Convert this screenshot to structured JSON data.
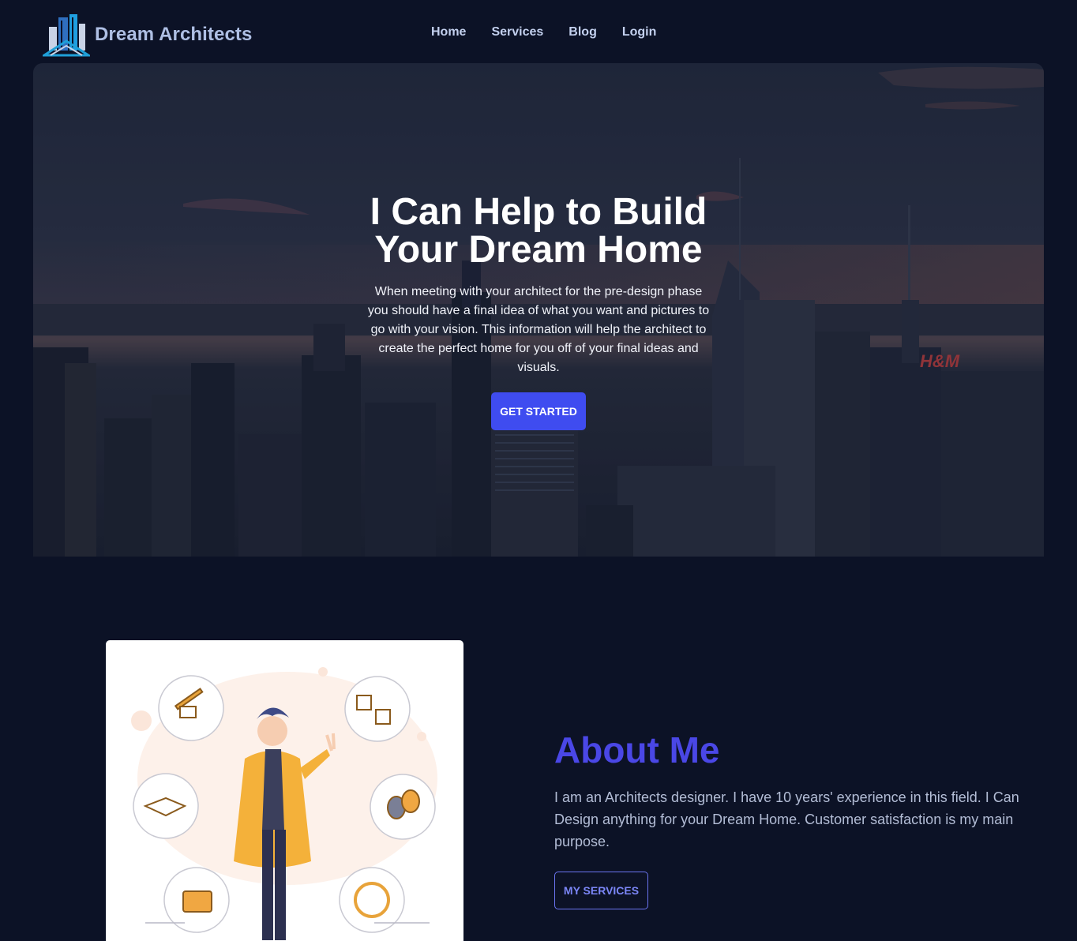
{
  "brand": {
    "name": "Dream Architects",
    "logo_icon": "city-buildings-logo"
  },
  "nav": {
    "items": [
      "Home",
      "Services",
      "Blog",
      "Login"
    ]
  },
  "hero": {
    "title": "I Can Help to Build Your Dream Home",
    "text": "When meeting with your architect for the pre-design phase you should have a final idea of what you want and pictures to go with your vision. This information will help the architect to create the perfect home for you off of your final ideas and visuals.",
    "cta_label": "GET STARTED",
    "background": "city-skyline-dusk-photo",
    "billboard_text": "H&M"
  },
  "about": {
    "title": "About Me",
    "text": "I am an Architects designer. I have 10 years' experience in this field. I Can Design anything for your Dream Home. Customer satisfaction is my main purpose.",
    "button_label": "MY SERVICES",
    "illustration": "architect-character-with-ideas"
  },
  "colors": {
    "background": "#0c1226",
    "accent": "#3f4cf0",
    "heading_accent": "#4a47e6",
    "nav_text": "#c3d0ee",
    "body_text": "#b3bdd6"
  }
}
